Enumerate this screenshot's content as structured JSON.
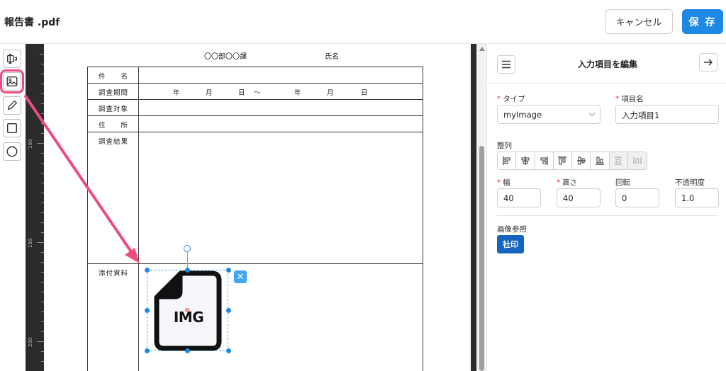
{
  "header": {
    "doc_title": "報告書 .pdf",
    "cancel_label": "キャンセル",
    "save_label": "保 存"
  },
  "toolbar": {
    "tools": [
      {
        "name": "text-field-icon",
        "active": false
      },
      {
        "name": "image-icon",
        "active": true
      },
      {
        "name": "pencil-icon",
        "active": false
      },
      {
        "name": "square-icon",
        "active": false
      },
      {
        "name": "circle-icon",
        "active": false
      }
    ]
  },
  "ruler": {
    "labels": [
      "100",
      "150",
      "200"
    ]
  },
  "form": {
    "dept": "〇〇部〇〇課",
    "name_label": "氏名",
    "rows": {
      "item_name": "件　　名",
      "period": "調査期間",
      "target": "調査対象",
      "address": "住　　所",
      "result": "調査結果",
      "attachment": "添付資料"
    },
    "period_parts": [
      "年",
      "月",
      "日",
      "〜",
      "年",
      "月",
      "日"
    ]
  },
  "image_element": {
    "icon_text": "IMG",
    "delete_glyph": "✕"
  },
  "panel": {
    "title": "入力項目を編集",
    "type_label": "タイプ",
    "type_value": "myImage",
    "item_name_label": "項目名",
    "item_name_value": "入力項目1",
    "align_label": "整列",
    "width_label": "幅",
    "width_value": "40",
    "height_label": "高さ",
    "height_value": "40",
    "rotation_label": "回転",
    "rotation_value": "0",
    "opacity_label": "不透明度",
    "opacity_value": "1.0",
    "image_ref_label": "画像参照",
    "image_ref_button": "社印"
  },
  "colors": {
    "accent": "#1e88e5",
    "highlight": "#ef4c7b",
    "ruler": "#2c2c2c"
  }
}
